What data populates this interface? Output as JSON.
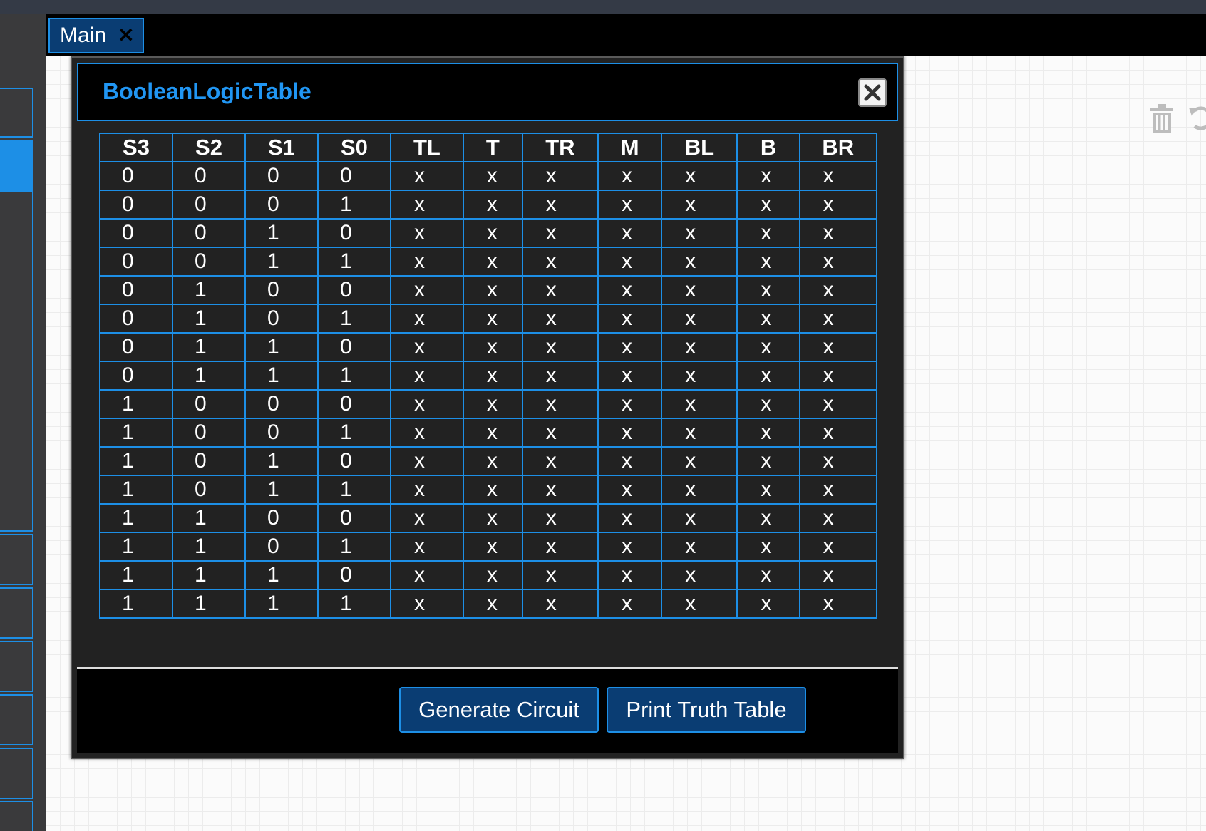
{
  "tabbar": {
    "tab_label": "Main",
    "tab_close": "✕"
  },
  "dialog": {
    "title": "BooleanLogicTable",
    "close_glyph": "✕"
  },
  "truth_table": {
    "headers": [
      "S3",
      "S2",
      "S1",
      "S0",
      "TL",
      "T",
      "TR",
      "M",
      "BL",
      "B",
      "BR"
    ],
    "rows": [
      [
        "0",
        "0",
        "0",
        "0",
        "x",
        "x",
        "x",
        "x",
        "x",
        "x",
        "x"
      ],
      [
        "0",
        "0",
        "0",
        "1",
        "x",
        "x",
        "x",
        "x",
        "x",
        "x",
        "x"
      ],
      [
        "0",
        "0",
        "1",
        "0",
        "x",
        "x",
        "x",
        "x",
        "x",
        "x",
        "x"
      ],
      [
        "0",
        "0",
        "1",
        "1",
        "x",
        "x",
        "x",
        "x",
        "x",
        "x",
        "x"
      ],
      [
        "0",
        "1",
        "0",
        "0",
        "x",
        "x",
        "x",
        "x",
        "x",
        "x",
        "x"
      ],
      [
        "0",
        "1",
        "0",
        "1",
        "x",
        "x",
        "x",
        "x",
        "x",
        "x",
        "x"
      ],
      [
        "0",
        "1",
        "1",
        "0",
        "x",
        "x",
        "x",
        "x",
        "x",
        "x",
        "x"
      ],
      [
        "0",
        "1",
        "1",
        "1",
        "x",
        "x",
        "x",
        "x",
        "x",
        "x",
        "x"
      ],
      [
        "1",
        "0",
        "0",
        "0",
        "x",
        "x",
        "x",
        "x",
        "x",
        "x",
        "x"
      ],
      [
        "1",
        "0",
        "0",
        "1",
        "x",
        "x",
        "x",
        "x",
        "x",
        "x",
        "x"
      ],
      [
        "1",
        "0",
        "1",
        "0",
        "x",
        "x",
        "x",
        "x",
        "x",
        "x",
        "x"
      ],
      [
        "1",
        "0",
        "1",
        "1",
        "x",
        "x",
        "x",
        "x",
        "x",
        "x",
        "x"
      ],
      [
        "1",
        "1",
        "0",
        "0",
        "x",
        "x",
        "x",
        "x",
        "x",
        "x",
        "x"
      ],
      [
        "1",
        "1",
        "0",
        "1",
        "x",
        "x",
        "x",
        "x",
        "x",
        "x",
        "x"
      ],
      [
        "1",
        "1",
        "1",
        "0",
        "x",
        "x",
        "x",
        "x",
        "x",
        "x",
        "x"
      ],
      [
        "1",
        "1",
        "1",
        "1",
        "x",
        "x",
        "x",
        "x",
        "x",
        "x",
        "x"
      ]
    ]
  },
  "footer": {
    "generate_label": "Generate Circuit",
    "print_label": "Print Truth Table"
  },
  "tools": {
    "trash_icon": "trash-icon",
    "undo_icon": "undo-icon"
  },
  "colors": {
    "accent": "#1d8fe6",
    "title": "#2196f3",
    "button_bg": "#0a3d73",
    "dialog_bg": "#222222"
  }
}
